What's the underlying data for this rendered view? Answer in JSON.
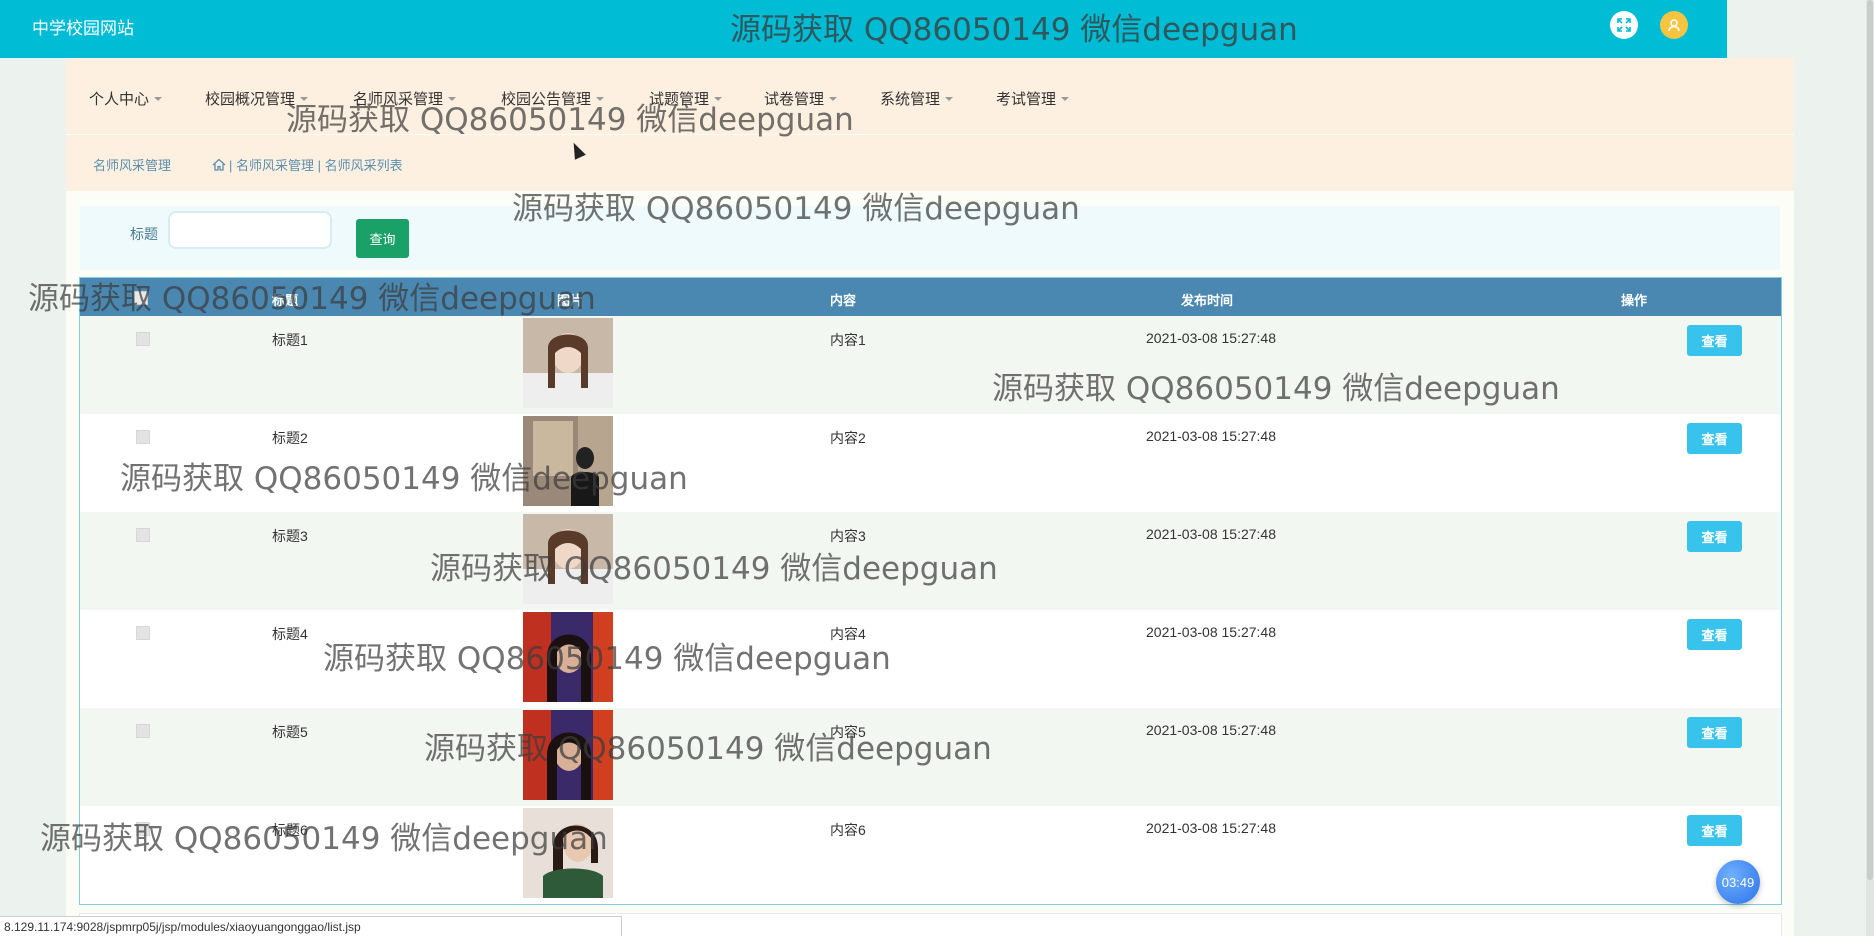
{
  "header": {
    "site_title": "中学校园网站",
    "watermark": "源码获取 QQ86050149 微信deepguan"
  },
  "nav": {
    "items": [
      {
        "label": "个人中心"
      },
      {
        "label": "校园概况管理"
      },
      {
        "label": "名师风采管理"
      },
      {
        "label": "校园公告管理"
      },
      {
        "label": "试题管理"
      },
      {
        "label": "试卷管理"
      },
      {
        "label": "系统管理"
      },
      {
        "label": "考试管理"
      }
    ]
  },
  "breadcrumb": {
    "title": "名师风采管理",
    "path": "| 名师风采管理 | 名师风采列表"
  },
  "search": {
    "label": "标题",
    "value": "",
    "button": "查询"
  },
  "table": {
    "headers": {
      "title": "标题",
      "image": "图片",
      "content": "内容",
      "time": "发布时间",
      "actions": "操作"
    },
    "rows": [
      {
        "title": "标题1",
        "content": "内容1",
        "time": "2021-03-08 15:27:48",
        "action": "查看"
      },
      {
        "title": "标题2",
        "content": "内容2",
        "time": "2021-03-08 15:27:48",
        "action": "查看"
      },
      {
        "title": "标题3",
        "content": "内容3",
        "time": "2021-03-08 15:27:48",
        "action": "查看"
      },
      {
        "title": "标题4",
        "content": "内容4",
        "time": "2021-03-08 15:27:48",
        "action": "查看"
      },
      {
        "title": "标题5",
        "content": "内容5",
        "time": "2021-03-08 15:27:48",
        "action": "查看"
      },
      {
        "title": "标题6",
        "content": "内容6",
        "time": "2021-03-08 15:27:48",
        "action": "查看"
      }
    ]
  },
  "status_url": "8.129.11.174:9028/jspmrp05j/jsp/modules/xiaoyuangonggao/list.jsp",
  "timer": "03:49",
  "colors": {
    "topbar": "#00bcd4",
    "nav_bg": "#fef0e0",
    "table_header": "#4a88b2",
    "search_button": "#1aa167",
    "view_button": "#37c3eb"
  }
}
